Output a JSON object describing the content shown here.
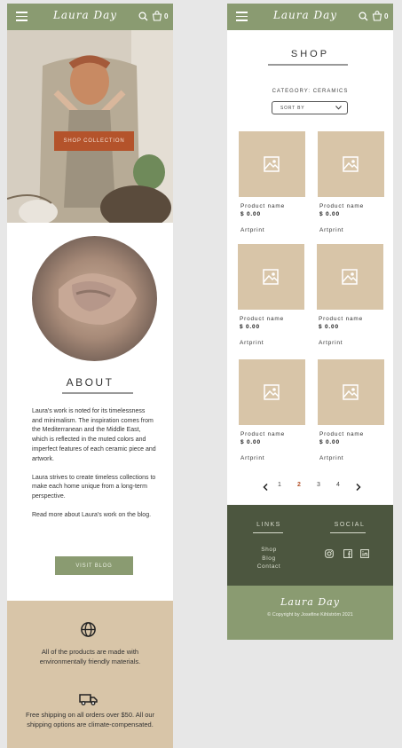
{
  "brand": "Laura Day",
  "cart_count": "0",
  "home": {
    "hero_button": "SHOP COLLECTION",
    "about_title": "ABOUT",
    "about_paragraphs": [
      "Laura's work is noted for its timelessness and minimalism. The inspiration comes from the Mediterranean and the Middle East, which is reflected in the muted colors and imperfect features of each ceramic piece and artwork.",
      "Laura strives to create timeless collections to make each home unique from a long-term perspective.",
      "Read more about Laura's work on the blog."
    ],
    "visit_button": "VISIT BLOG",
    "info": [
      {
        "icon": "globe-icon",
        "text": "All of the products are made with environmentally friendly materials."
      },
      {
        "icon": "truck-icon",
        "text": "Free shipping on all orders over $50. All our shipping options are climate-compensated."
      }
    ]
  },
  "shop": {
    "title": "SHOP",
    "category": "CATEGORY: CERAMICS",
    "sort_label": "SORT BY",
    "products": [
      {
        "name": "Product name",
        "price": "$ 0.00",
        "type": "Artprint"
      },
      {
        "name": "Product name",
        "price": "$ 0.00",
        "type": "Artprint"
      },
      {
        "name": "Product name",
        "price": "$ 0.00",
        "type": "Artprint"
      },
      {
        "name": "Product name",
        "price": "$ 0.00",
        "type": "Artprint"
      },
      {
        "name": "Product name",
        "price": "$ 0.00",
        "type": "Artprint"
      },
      {
        "name": "Product name",
        "price": "$ 0.00",
        "type": "Artprint"
      }
    ],
    "pages": [
      "1",
      "2",
      "3",
      "4"
    ],
    "current_page": "2",
    "footer": {
      "links_title": "LINKS",
      "links": [
        "Shop",
        "Blog",
        "Contact"
      ],
      "social_title": "SOCIAL",
      "social_icons": [
        "instagram-icon",
        "facebook-icon",
        "linkedin-icon"
      ],
      "copyright": "© Copyright by Josefine Kihlström 2021"
    }
  },
  "colors": {
    "header_green": "#8a9b71",
    "accent_orange": "#b4532b",
    "sand": "#d8c5a8",
    "footer_dark": "#4c563f"
  }
}
